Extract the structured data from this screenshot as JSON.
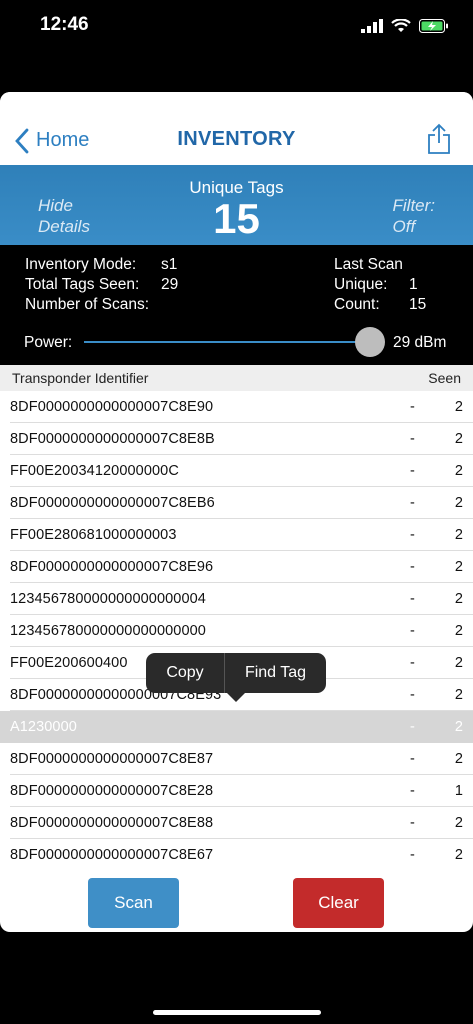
{
  "status_bar": {
    "time": "12:46"
  },
  "nav": {
    "back_label": "Home",
    "title": "INVENTORY"
  },
  "summary": {
    "hide_line1": "Hide",
    "hide_line2": "Details",
    "unique_label": "Unique Tags",
    "unique_count": "15",
    "filter_line1": "Filter:",
    "filter_line2": "Off"
  },
  "details": {
    "mode_label": "Inventory Mode:",
    "mode_value": "s1",
    "total_label": "Total Tags Seen:",
    "total_value": "29",
    "scans_label": "Number of Scans:",
    "last_scan_label": "Last Scan",
    "unique_label": "Unique:",
    "unique_value": "1",
    "count_label": "Count:",
    "count_value": "15",
    "power_label": "Power:",
    "power_value": "29 dBm"
  },
  "list": {
    "col_id": "Transponder Identifier",
    "col_seen": "Seen",
    "rows": [
      {
        "id": "8DF0000000000000007C8E90",
        "dash": "-",
        "seen": "2"
      },
      {
        "id": "8DF0000000000000007C8E8B",
        "dash": "-",
        "seen": "2"
      },
      {
        "id": "FF00E20034120000000C",
        "dash": "-",
        "seen": "2"
      },
      {
        "id": "8DF0000000000000007C8EB6",
        "dash": "-",
        "seen": "2"
      },
      {
        "id": "FF00E280681000000003",
        "dash": "-",
        "seen": "2"
      },
      {
        "id": "8DF0000000000000007C8E96",
        "dash": "-",
        "seen": "2"
      },
      {
        "id": "123456780000000000000004",
        "dash": "-",
        "seen": "2"
      },
      {
        "id": "123456780000000000000000",
        "dash": "-",
        "seen": "2"
      },
      {
        "id": "FF00E200600400",
        "dash": "-",
        "seen": "2"
      },
      {
        "id": "8DF00000000000000007C8E93",
        "dash": "-",
        "seen": "2"
      },
      {
        "id": "A1230000",
        "dash": "-",
        "seen": "2"
      },
      {
        "id": "8DF0000000000000007C8E87",
        "dash": "-",
        "seen": "2"
      },
      {
        "id": "8DF0000000000000007C8E28",
        "dash": "-",
        "seen": "1"
      },
      {
        "id": "8DF0000000000000007C8E88",
        "dash": "-",
        "seen": "2"
      },
      {
        "id": "8DF0000000000000007C8E67",
        "dash": "-",
        "seen": "2"
      }
    ]
  },
  "context_menu": {
    "copy": "Copy",
    "find": "Find Tag"
  },
  "buttons": {
    "scan": "Scan",
    "clear": "Clear"
  },
  "colors": {
    "accent": "#2d7fc1",
    "header_blue": "#3a8dc7",
    "clear_red": "#c32b2b"
  },
  "icons": [
    "cellular-signal-icon",
    "wifi-icon",
    "battery-charging-icon",
    "chevron-left-icon",
    "share-icon"
  ]
}
